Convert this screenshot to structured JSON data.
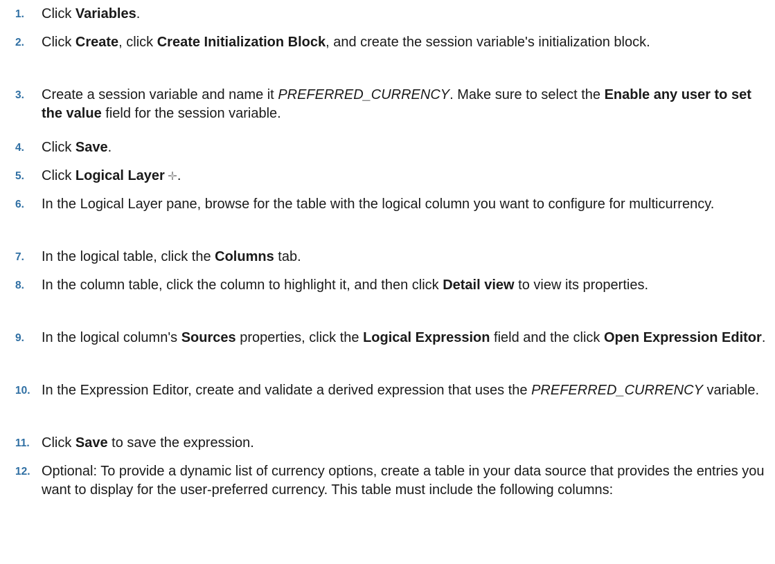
{
  "steps": [
    {
      "number": "1.",
      "parts": [
        {
          "text": "Click "
        },
        {
          "text": "Variables",
          "style": "bold"
        },
        {
          "text": "."
        }
      ]
    },
    {
      "number": "2.",
      "parts": [
        {
          "text": "Click "
        },
        {
          "text": "Create",
          "style": "bold"
        },
        {
          "text": ", click "
        },
        {
          "text": "Create Initialization Block",
          "style": "bold"
        },
        {
          "text": ", and create the session variable's initialization block."
        }
      ]
    },
    {
      "number": "3.",
      "parts": [
        {
          "text": "Create a session variable and name it "
        },
        {
          "text": "PREFERRED_CURRENCY",
          "style": "italic"
        },
        {
          "text": ". Make sure to select the "
        },
        {
          "text": "Enable any user to set the value",
          "style": "bold"
        },
        {
          "text": " field for the session variable."
        }
      ]
    },
    {
      "number": "4.",
      "parts": [
        {
          "text": "Click "
        },
        {
          "text": "Save",
          "style": "bold"
        },
        {
          "text": "."
        }
      ]
    },
    {
      "number": "5.",
      "parts": [
        {
          "text": "Click "
        },
        {
          "text": "Logical Layer",
          "style": "bold"
        },
        {
          "icon": "logical-layer-icon"
        },
        {
          "text": "."
        }
      ]
    },
    {
      "number": "6.",
      "parts": [
        {
          "text": "In the Logical Layer pane, browse for the table with the logical column you want to configure for multicurrency."
        }
      ]
    },
    {
      "number": "7.",
      "parts": [
        {
          "text": "In the logical table, click the "
        },
        {
          "text": "Columns",
          "style": "bold"
        },
        {
          "text": " tab."
        }
      ]
    },
    {
      "number": "8.",
      "parts": [
        {
          "text": "In the column table, click the column to highlight it, and then click "
        },
        {
          "text": "Detail view",
          "style": "bold"
        },
        {
          "text": " to view its properties."
        }
      ]
    },
    {
      "number": "9.",
      "parts": [
        {
          "text": "In the logical column's "
        },
        {
          "text": "Sources",
          "style": "bold"
        },
        {
          "text": " properties, click the "
        },
        {
          "text": "Logical Expression",
          "style": "bold"
        },
        {
          "text": " field and the click "
        },
        {
          "text": "Open Expression Editor",
          "style": "bold"
        },
        {
          "text": "."
        }
      ]
    },
    {
      "number": "10.",
      "parts": [
        {
          "text": "In the Expression Editor, create and validate a derived expression that uses the "
        },
        {
          "text": "PREFERRED_CURRENCY",
          "style": "italic"
        },
        {
          "text": " variable."
        }
      ]
    },
    {
      "number": "11.",
      "parts": [
        {
          "text": "Click "
        },
        {
          "text": "Save",
          "style": "bold"
        },
        {
          "text": " to save the expression."
        }
      ]
    },
    {
      "number": "12.",
      "parts": [
        {
          "text": "Optional: To provide a dynamic list of currency options, create a table in your data source that provides the entries you want to display for the user-preferred currency. This table must include the following columns:"
        }
      ]
    }
  ]
}
